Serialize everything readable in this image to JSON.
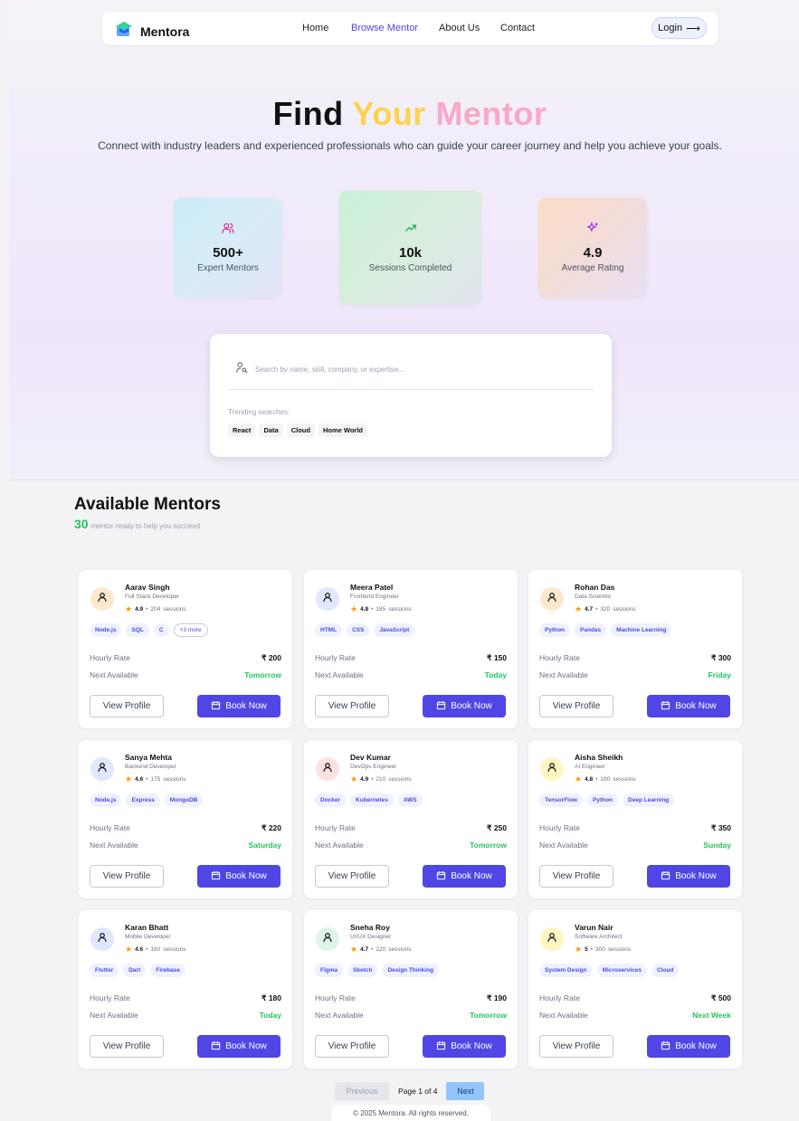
{
  "nav": {
    "brand": "Mentora",
    "links": [
      "Home",
      "Browse Mentor",
      "About Us",
      "Contact"
    ],
    "active": "Browse Mentor",
    "login_label": "Login",
    "accent": "#4f46e5"
  },
  "hero": {
    "title_w1": "Find",
    "title_w2": "Your",
    "title_w3": "Mentor",
    "subtitle": "Connect with industry leaders and experienced professionals who can guide your career journey and help you achieve your goals.",
    "colors": {
      "your": "#fcd34d",
      "mentor": "#f9a8c9"
    }
  },
  "stats": [
    {
      "icon": "users-icon",
      "value": "500+",
      "label": "Expert Mentors"
    },
    {
      "icon": "trending-up-icon",
      "value": "10k",
      "label": "Sessions Completed"
    },
    {
      "icon": "sparkles-icon",
      "value": "4.9",
      "label": "Average Rating"
    }
  ],
  "search": {
    "placeholder": "Search by name, skill, company, or expertise...",
    "value": "",
    "trending_label": "Trending searches:",
    "trending": [
      "React",
      "Data",
      "Cloud",
      "Home World"
    ]
  },
  "section": {
    "title": "Available Mentors",
    "count": "30",
    "subtitle": "mentor ready to help you succeed"
  },
  "labels": {
    "hourly_rate": "Hourly Rate",
    "next_available": "Next Available",
    "view_profile": "View Profile",
    "book_now": "Book Now",
    "sessions_suffix": "sessions"
  },
  "mentors": [
    {
      "name": "Aarav Singh",
      "role": "Full Stack Developer",
      "rating": "4.9",
      "sessions": "204",
      "tags": [
        "Node.js",
        "SQL",
        "C"
      ],
      "more": "+3 more",
      "rate": "₹ 200",
      "next": "Tomorrow",
      "avatar_color": "#fde8cf"
    },
    {
      "name": "Meera Patel",
      "role": "Frontend Engineer",
      "rating": "4.8",
      "sessions": "185",
      "tags": [
        "HTML",
        "CSS",
        "JavaScript"
      ],
      "more": "",
      "rate": "₹ 150",
      "next": "Today",
      "avatar_color": "#e0e7ff"
    },
    {
      "name": "Rohan Das",
      "role": "Data Scientist",
      "rating": "4.7",
      "sessions": "320",
      "tags": [
        "Python",
        "Pandas",
        "Machine Learning"
      ],
      "more": "",
      "rate": "₹ 300",
      "next": "Friday",
      "avatar_color": "#fde8cf"
    },
    {
      "name": "Sanya Mehta",
      "role": "Backend Developer",
      "rating": "4.6",
      "sessions": "175",
      "tags": [
        "Node.js",
        "Express",
        "MongoDB"
      ],
      "more": "",
      "rate": "₹ 220",
      "next": "Saturday",
      "avatar_color": "#e0e7ff"
    },
    {
      "name": "Dev Kumar",
      "role": "DevOps Engineer",
      "rating": "4.9",
      "sessions": "210",
      "tags": [
        "Docker",
        "Kubernetes",
        "AWS"
      ],
      "more": "",
      "rate": "₹ 250",
      "next": "Tomorrow",
      "avatar_color": "#fde0e0"
    },
    {
      "name": "Aisha Sheikh",
      "role": "AI Engineer",
      "rating": "4.8",
      "sessions": "190",
      "tags": [
        "TensorFlow",
        "Python",
        "Deep Learning"
      ],
      "more": "",
      "rate": "₹ 350",
      "next": "Sunday",
      "avatar_color": "#fdf6c3"
    },
    {
      "name": "Karan Bhatt",
      "role": "Mobile Developer",
      "rating": "4.6",
      "sessions": "160",
      "tags": [
        "Flutter",
        "Dart",
        "Firebase"
      ],
      "more": "",
      "rate": "₹ 180",
      "next": "Today",
      "avatar_color": "#e0e7ff"
    },
    {
      "name": "Sneha Roy",
      "role": "UI/UX Designer",
      "rating": "4.7",
      "sessions": "220",
      "tags": [
        "Figma",
        "Sketch",
        "Design Thinking"
      ],
      "more": "",
      "rate": "₹ 190",
      "next": "Tomorrow",
      "avatar_color": "#dcf5e4"
    },
    {
      "name": "Varun Nair",
      "role": "Software Architect",
      "rating": "5",
      "sessions": "300",
      "tags": [
        "System Design",
        "Microservices",
        "Cloud"
      ],
      "more": "",
      "rate": "₹ 500",
      "next": "Next Week",
      "avatar_color": "#fdf6c3"
    }
  ],
  "pagination": {
    "prev": "Previous",
    "info": "Page 1 of 4",
    "next": "Next"
  },
  "footer": "© 2025 Mentora. All rights reserved."
}
